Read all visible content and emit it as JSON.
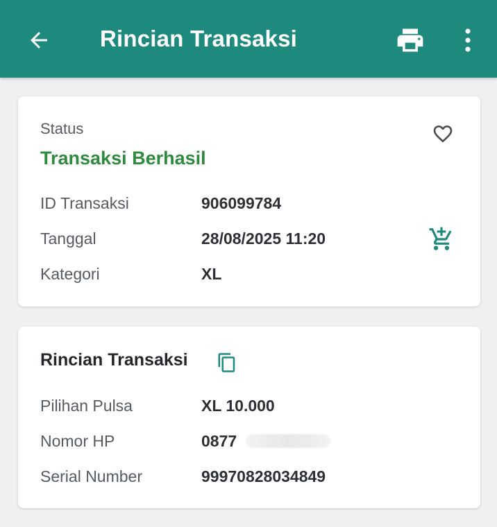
{
  "appbar": {
    "title": "Rincian Transaksi",
    "back_icon": "arrow-left-icon",
    "print_icon": "printer-icon",
    "more_icon": "more-vertical-icon",
    "background_color": "#1e8a7e"
  },
  "status_card": {
    "status_label": "Status",
    "status_value": "Transaksi Berhasil",
    "status_color": "#2e8b3e",
    "favorite_icon": "heart-outline-icon",
    "cart_icon": "cart-add-icon",
    "rows": [
      {
        "label": "ID Transaksi",
        "value": "906099784"
      },
      {
        "label": "Tanggal",
        "value": "28/08/2025 11:20"
      },
      {
        "label": "Kategori",
        "value": "XL"
      }
    ]
  },
  "detail_card": {
    "title": "Rincian Transaksi",
    "copy_icon": "copy-icon",
    "rows": [
      {
        "label": "Pilihan Pulsa",
        "value": "XL 10.000"
      },
      {
        "label": "Nomor HP",
        "value": "0877"
      },
      {
        "label": "Serial Number",
        "value": "99970828034849"
      }
    ]
  }
}
